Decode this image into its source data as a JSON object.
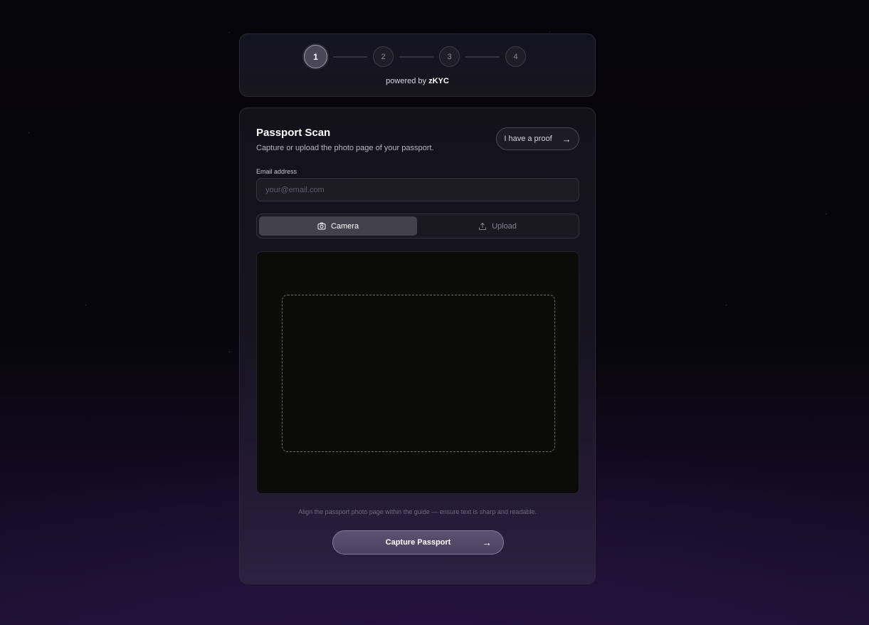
{
  "stepper": {
    "steps": [
      "1",
      "2",
      "3",
      "4"
    ],
    "active_step": 1,
    "powered_prefix": "powered by",
    "powered_brand": "zKYC"
  },
  "main": {
    "title": "Passport Scan",
    "subtitle": "Capture or upload the photo page of your passport.",
    "proof_button_label": "I have a proof",
    "email": {
      "label": "Email address",
      "placeholder": "your@email.com",
      "value": ""
    },
    "tabs": [
      {
        "label": "Camera",
        "icon": "camera-icon",
        "active": true
      },
      {
        "label": "Upload",
        "icon": "upload-icon",
        "active": false
      }
    ],
    "hint": "Align the passport photo page within the guide — ensure text is sharp and readable.",
    "capture_button_label": "Capture Passport"
  },
  "colors": {
    "background": "#07060d",
    "card_border": "#2c2a36",
    "active_tab": "#43414b",
    "accent_button": "#5c5170"
  }
}
